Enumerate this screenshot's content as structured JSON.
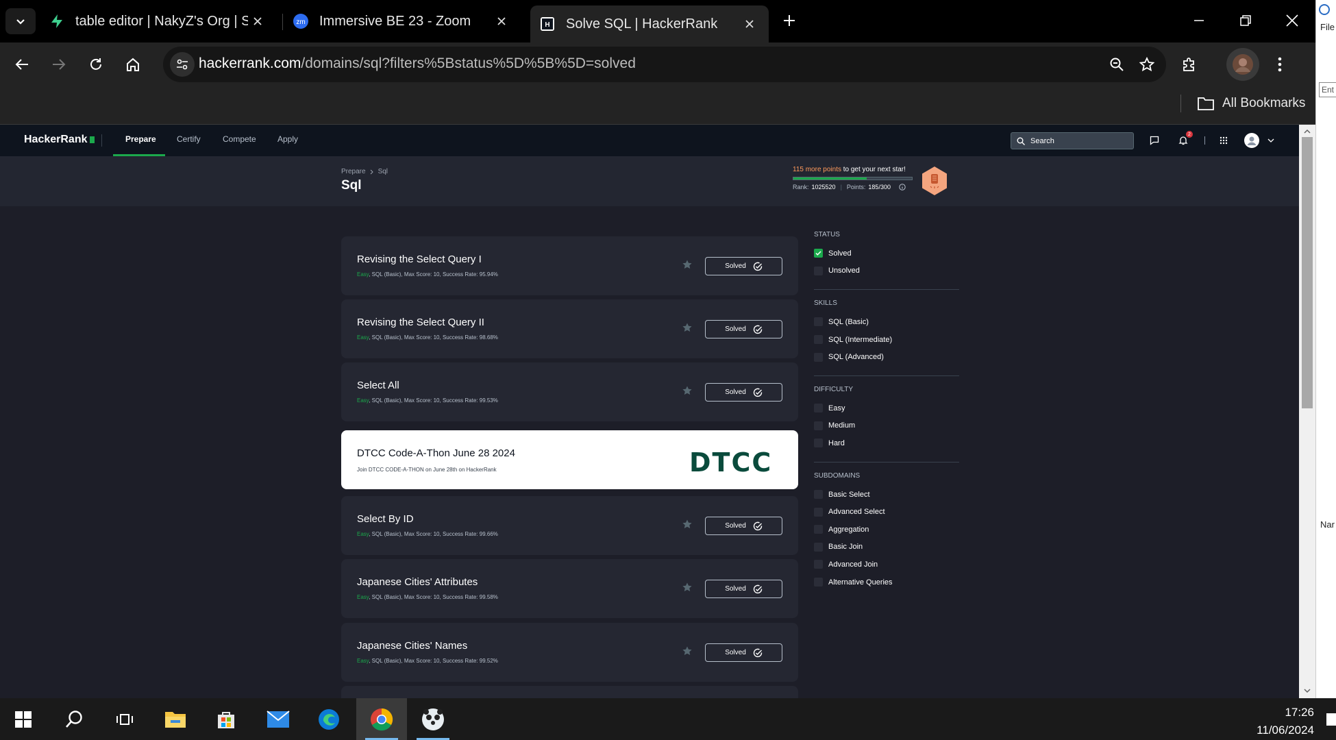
{
  "browser": {
    "tabs": [
      {
        "title": "table editor | NakyZ's Org | Supabase",
        "favicon": "supabase-icon"
      },
      {
        "title": "Immersive BE 23 - Zoom",
        "favicon": "zoom-icon"
      },
      {
        "title": "Solve SQL | HackerRank",
        "favicon": "hackerrank-icon"
      }
    ],
    "url_host": "hackerrank.com",
    "url_path": "/domains/sql?filters%5Bstatus%5D%5B%5D=solved",
    "bookmarks_label": "All Bookmarks"
  },
  "hr_nav": {
    "logo": "HackerRank",
    "items": [
      "Prepare",
      "Certify",
      "Compete",
      "Apply"
    ],
    "search_placeholder": "Search",
    "notification_count": "2"
  },
  "page": {
    "breadcrumb": [
      "Prepare",
      "Sql"
    ],
    "title": "Sql",
    "points_needed": "115 more points",
    "points_suffix": " to get your next star!",
    "rank_label": "Rank:",
    "rank_value": "1025520",
    "points_label": "Points:",
    "points_value": "185/300",
    "progress_fraction": 0.617
  },
  "challenges": [
    {
      "title": "Revising the Select Query I",
      "difficulty": "Easy",
      "meta": ", SQL (Basic), Max Score: 10, Success Rate: 95.94%",
      "status": "Solved"
    },
    {
      "title": "Revising the Select Query II",
      "difficulty": "Easy",
      "meta": ", SQL (Basic), Max Score: 10, Success Rate: 98.68%",
      "status": "Solved"
    },
    {
      "title": "Select All",
      "difficulty": "Easy",
      "meta": ", SQL (Basic), Max Score: 10, Success Rate: 99.53%",
      "status": "Solved"
    },
    {
      "title": "Select By ID",
      "difficulty": "Easy",
      "meta": ", SQL (Basic), Max Score: 10, Success Rate: 99.66%",
      "status": "Solved"
    },
    {
      "title": "Japanese Cities' Attributes",
      "difficulty": "Easy",
      "meta": ", SQL (Basic), Max Score: 10, Success Rate: 99.58%",
      "status": "Solved"
    },
    {
      "title": "Japanese Cities' Names",
      "difficulty": "Easy",
      "meta": ", SQL (Basic), Max Score: 10, Success Rate: 99.52%",
      "status": "Solved"
    }
  ],
  "promo": {
    "title": "DTCC Code-A-Thon June 28 2024",
    "description": "Join DTCC CODE-A-THON on June 28th on HackerRank",
    "logo_text": "DTCC"
  },
  "filters": {
    "status": {
      "heading": "STATUS",
      "options": [
        {
          "label": "Solved",
          "checked": true
        },
        {
          "label": "Unsolved",
          "checked": false
        }
      ]
    },
    "skills": {
      "heading": "SKILLS",
      "options": [
        {
          "label": "SQL (Basic)",
          "checked": false
        },
        {
          "label": "SQL (Intermediate)",
          "checked": false
        },
        {
          "label": "SQL (Advanced)",
          "checked": false
        }
      ]
    },
    "difficulty": {
      "heading": "DIFFICULTY",
      "options": [
        {
          "label": "Easy",
          "checked": false
        },
        {
          "label": "Medium",
          "checked": false
        },
        {
          "label": "Hard",
          "checked": false
        }
      ]
    },
    "subdomains": {
      "heading": "SUBDOMAINS",
      "options": [
        {
          "label": "Basic Select",
          "checked": false
        },
        {
          "label": "Advanced Select",
          "checked": false
        },
        {
          "label": "Aggregation",
          "checked": false
        },
        {
          "label": "Basic Join",
          "checked": false
        },
        {
          "label": "Advanced Join",
          "checked": false
        },
        {
          "label": "Alternative Queries",
          "checked": false
        }
      ]
    }
  },
  "taskbar": {
    "time": "17:26",
    "date": "11/06/2024"
  },
  "side_window": {
    "menu": "File",
    "input_placeholder": "Ent",
    "section": "Nar"
  },
  "colors": {
    "accent": "#1ba94c",
    "easy": "#1ba94c",
    "points_highlight": "#ff9a5c",
    "page_bg": "#1d1e28",
    "card_bg": "#252732"
  }
}
